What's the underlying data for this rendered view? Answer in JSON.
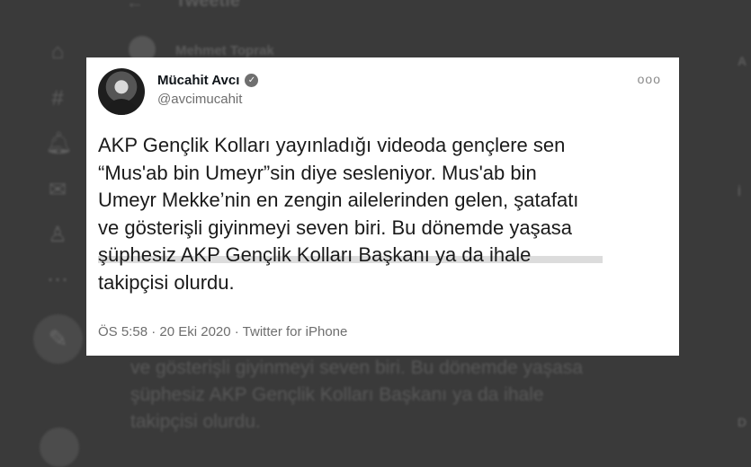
{
  "background": {
    "header_title": "Tweetle",
    "back_icon": "back-arrow-icon",
    "author_name": "Mehmet Toprak",
    "text_lines": [
      "ve gösterişli giyinmeyi seven biri. Bu dönemde yaşasa",
      "şüphesiz AKP Gençlik Kolları Başkanı ya da ihale",
      "takipçisi olurdu."
    ],
    "nav_icons": [
      "home-icon",
      "explore-icon",
      "notifications-icon",
      "messages-icon",
      "profile-icon",
      "more-icon"
    ],
    "right_letters": [
      "A",
      "İ",
      "D"
    ]
  },
  "tweet": {
    "author": "Mücahit Avcı",
    "handle": "@avcimucahit",
    "verified": true,
    "more_label": "ooo",
    "text_lines": [
      "AKP Gençlik Kolları yayınladığı videoda gençlere sen",
      "“Mus'ab bin Umeyr”sin diye sesleniyor. Mus'ab bin",
      "Umeyr Mekke’nin en zengin ailelerinden gelen, şatafatı",
      "ve gösterişli giyinmeyi seven biri. Bu dönemde yaşasa",
      "şüphesiz AKP Gençlik Kolları Başkanı ya da ihale",
      "takipçisi olurdu."
    ],
    "meta": "ÖS 5:58 · 20 Eki 2020 · Twitter for iPhone"
  },
  "colors": {
    "card": "#ffffff",
    "backdrop": "#3a3a3a"
  }
}
